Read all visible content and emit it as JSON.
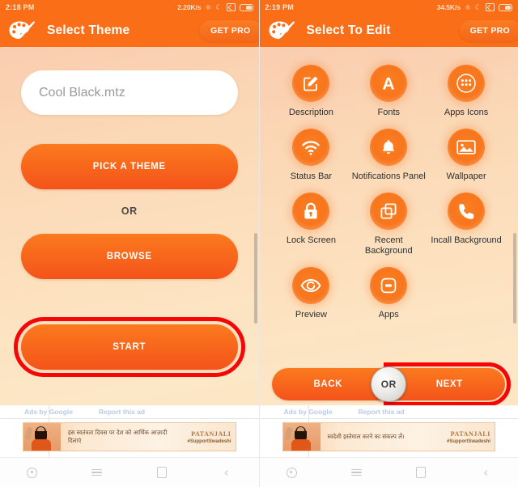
{
  "accent": {
    "header_orange": "#f96e16",
    "button_orange": "#f4531a",
    "highlight_red": "#f60606",
    "background_peach": "#fbd8b6"
  },
  "screens": [
    {
      "status_bar": {
        "time": "2:18 PM",
        "network_speed": "2.20K/s",
        "bluetooth_icon": "bluetooth-icon",
        "wifi_icon": "wifi-icon",
        "sim_icon": "no-sim-icon",
        "battery_icon": "battery-icon"
      },
      "app_bar": {
        "logo_icon": "palette-icon",
        "title": "Select Theme",
        "get_pro_label": "GET PRO"
      },
      "theme_field": {
        "value": "Cool Black.mtz",
        "placeholder": "Cool Black.mtz"
      },
      "pick_theme_label": "PICK A THEME",
      "or_label": "OR",
      "browse_label": "BROWSE",
      "start_label": "START",
      "ad": {
        "ads_by_label": "Ads by Google",
        "report_label": "Report this ad",
        "headline": "इस स्वतंत्रता दिवस पर देश को आर्थिक आज़ादी दिलाएं",
        "brand": "PATANJALI",
        "hashtag": "#SupportSwadeshi"
      },
      "nav_bar": {
        "items": [
          {
            "icon": "assistant-circle-icon"
          },
          {
            "icon": "menu-icon"
          },
          {
            "icon": "home-square-icon"
          },
          {
            "icon": "back-chevron-icon"
          }
        ]
      }
    },
    {
      "status_bar": {
        "time": "2:19 PM",
        "network_speed": "34.5K/s",
        "bluetooth_icon": "bluetooth-icon",
        "wifi_icon": "wifi-icon",
        "sim_icon": "no-sim-icon",
        "battery_icon": "battery-icon"
      },
      "app_bar": {
        "logo_icon": "palette-icon",
        "title": "Select To Edit",
        "get_pro_label": "GET PRO"
      },
      "grid": [
        {
          "label": "Description",
          "icon": "edit-square-icon"
        },
        {
          "label": "Fonts",
          "icon": "letter-a-icon"
        },
        {
          "label": "Apps Icons",
          "icon": "app-drawer-dots-icon"
        },
        {
          "label": "Status Bar",
          "icon": "wifi-signal-icon"
        },
        {
          "label": "Notifications Panel",
          "icon": "bell-icon"
        },
        {
          "label": "Wallpaper",
          "icon": "image-photo-icon"
        },
        {
          "label": "Lock Screen",
          "icon": "lock-icon"
        },
        {
          "label": "Recent Background",
          "icon": "stacked-windows-icon"
        },
        {
          "label": "Incall Background",
          "icon": "phone-handset-icon"
        },
        {
          "label": "Preview",
          "icon": "eye-icon"
        },
        {
          "label": "Apps",
          "icon": "rounded-square-dash-icon"
        }
      ],
      "bottom": {
        "back_label": "BACK",
        "or_label": "OR",
        "next_label": "NEXT"
      },
      "ad": {
        "ads_by_label": "Ads by Google",
        "report_label": "Report this ad",
        "headline": "स्वदेशी इस्तेमाल करने का संकल्प लें।",
        "brand": "PATANJALI",
        "hashtag": "#SupportSwadeshi"
      },
      "nav_bar": {
        "items": [
          {
            "icon": "assistant-circle-icon"
          },
          {
            "icon": "menu-icon"
          },
          {
            "icon": "home-square-icon"
          },
          {
            "icon": "back-chevron-icon"
          }
        ]
      }
    }
  ]
}
